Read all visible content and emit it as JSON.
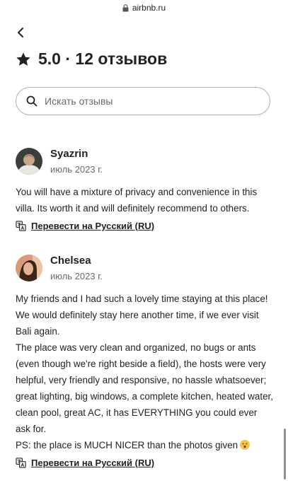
{
  "browser": {
    "url": "airbnb.ru"
  },
  "header": {
    "back_icon": "chevron-left-icon",
    "rating": "5.0 · 12 отзывов"
  },
  "search": {
    "placeholder": "Искать отзывы"
  },
  "reviews": [
    {
      "name": "Syazrin",
      "date": "июль 2023 г.",
      "paragraphs": [
        "You will have a mixture of privacy and convenience in this villa. Its worth it and will definitely recommend to others."
      ],
      "translate_label": "Перевести на Русский (RU)"
    },
    {
      "name": "Chelsea",
      "date": "июль 2023 г.",
      "paragraphs": [
        "My friends and I had such a lovely time staying at this place! We would definitely stay here another time, if we ever visit Bali again.",
        "The place was very clean and organized, no bugs or ants (even though we're right beside a field), the hosts were very helpful, very friendly and responsive, no hassle whatsoever; great lighting, big windows, a complete kitchen, heated water, clean pool, great AC, it has EVERYTHING you could ever ask for.",
        "PS: the place is MUCH NICER than the photos given"
      ],
      "emoji": "astonished-face-emoji",
      "translate_label": "Перевести на Русский (RU)"
    }
  ],
  "colors": {
    "text": "#222222",
    "secondary": "#6a6a6a",
    "border": "#b0b0b0"
  }
}
